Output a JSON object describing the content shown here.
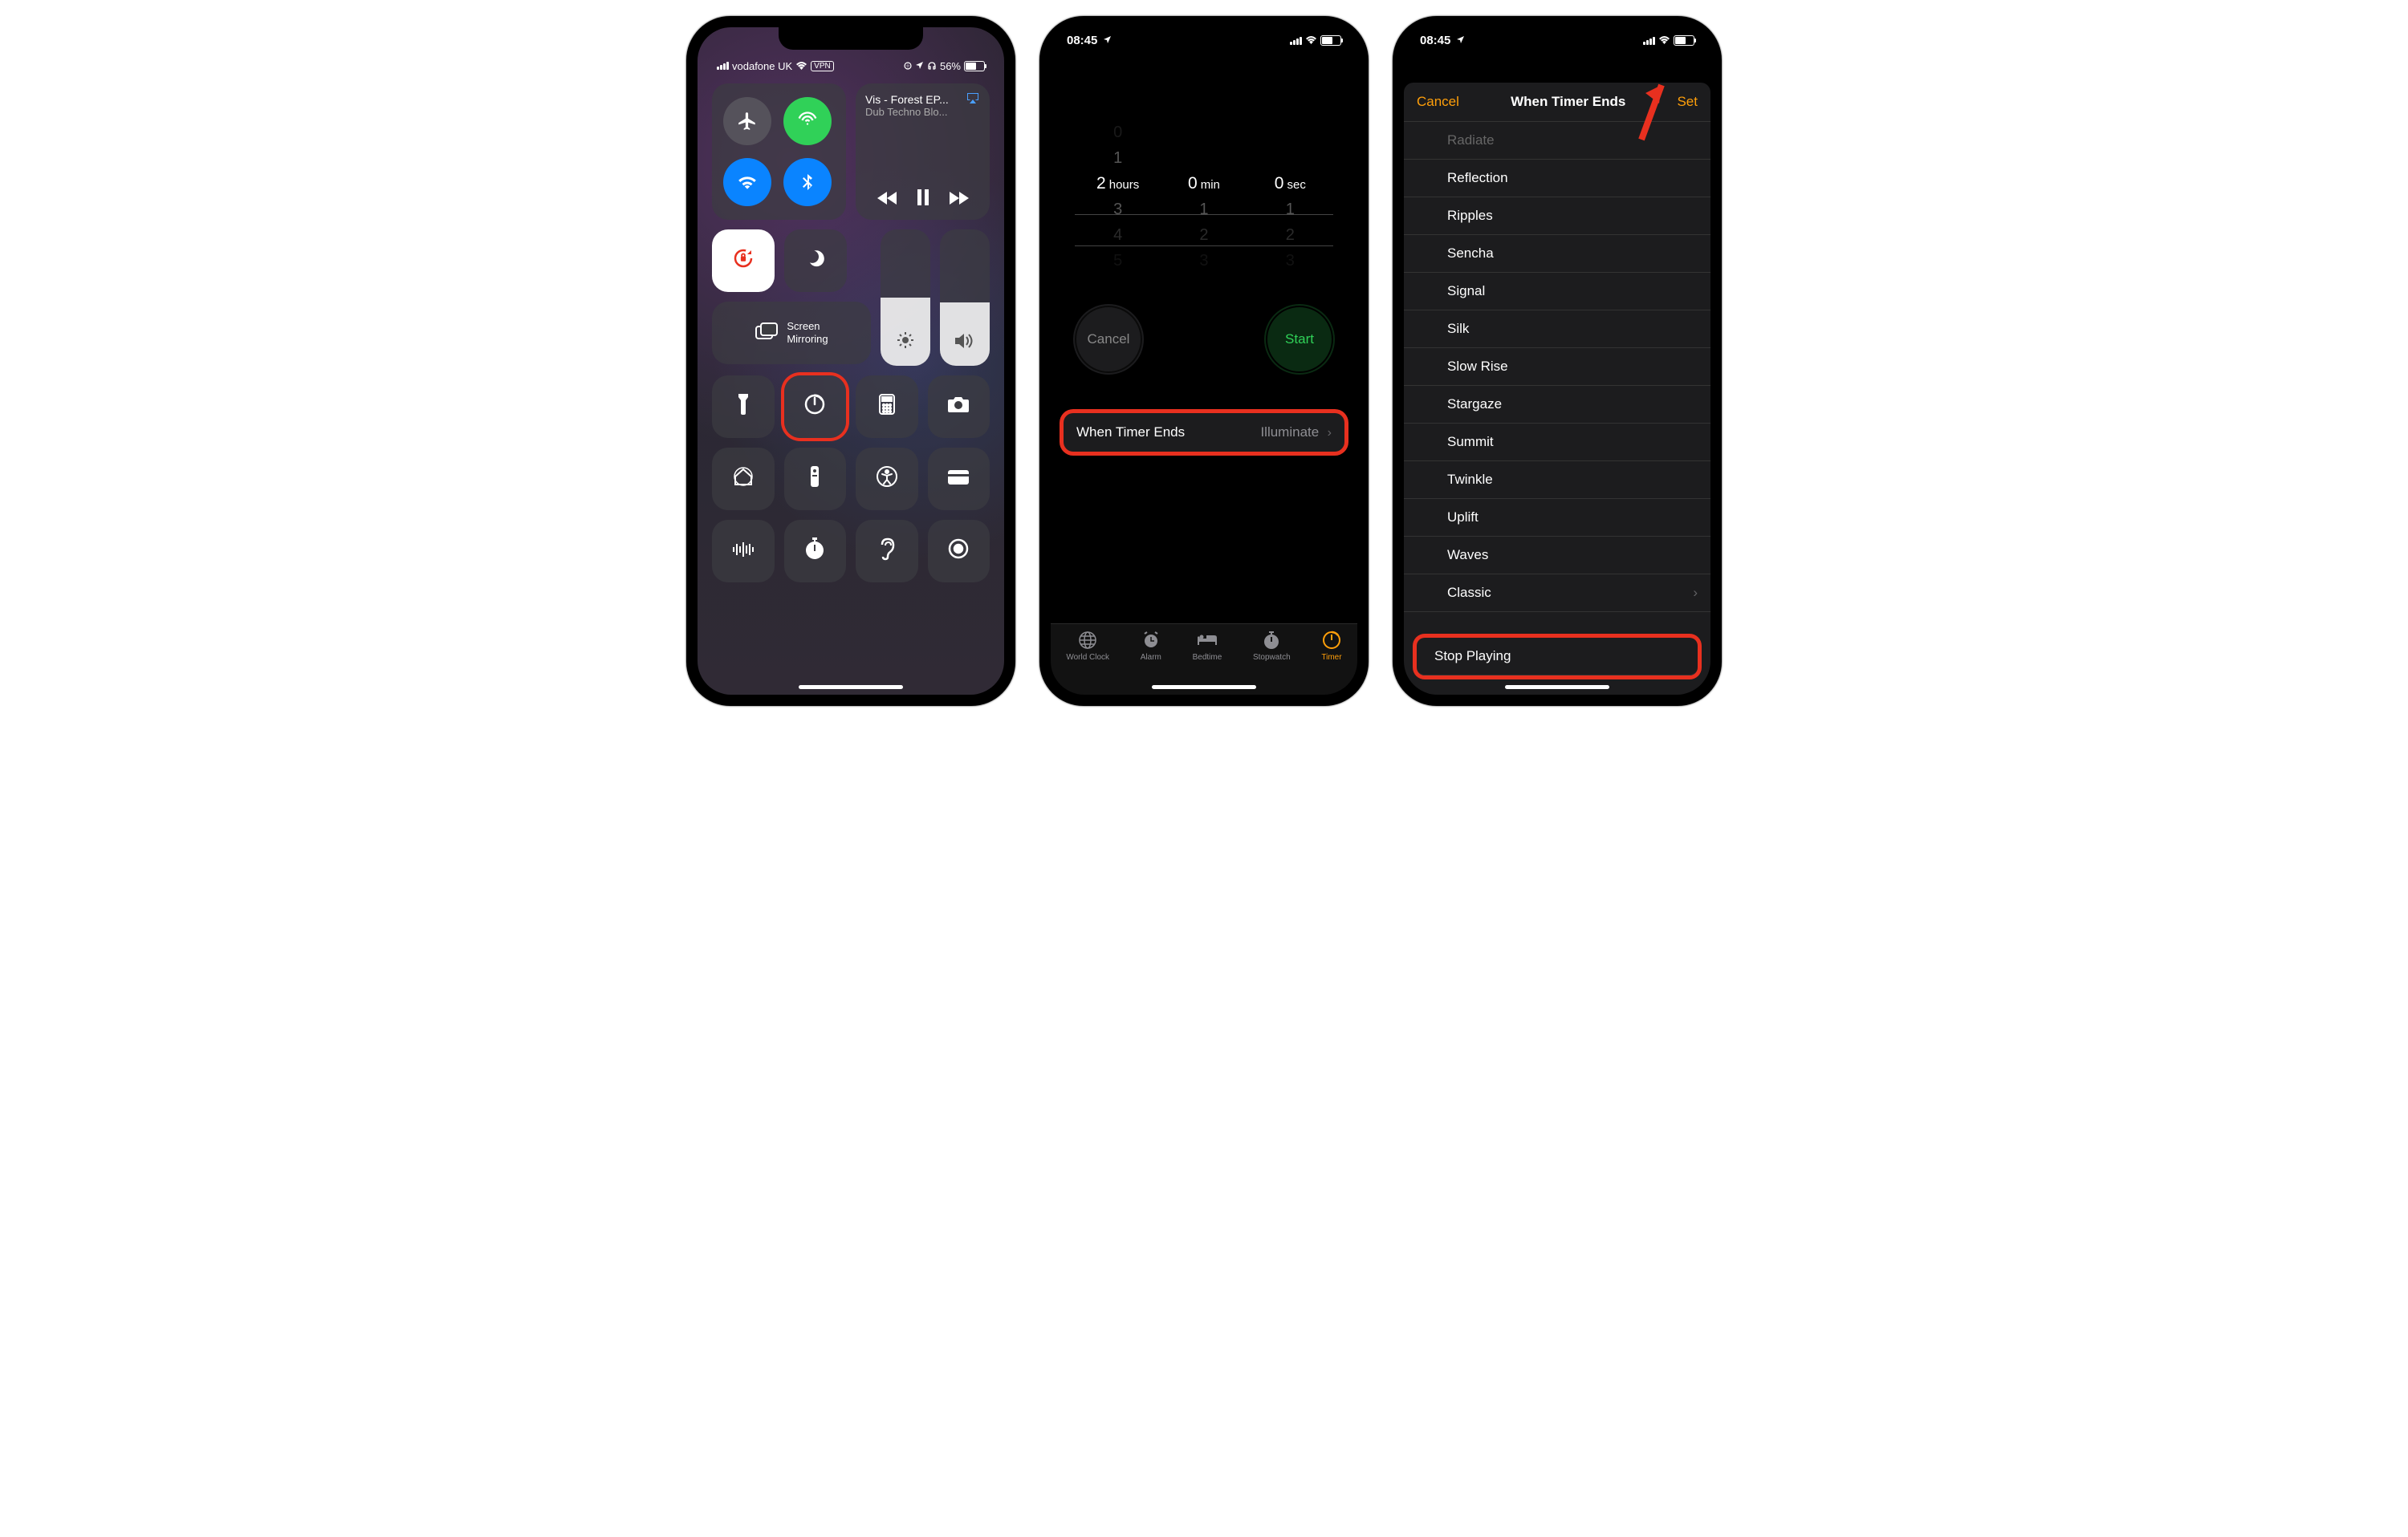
{
  "screen1": {
    "status": {
      "carrier": "vodafone UK",
      "vpn": "VPN",
      "battery": "56%"
    },
    "media": {
      "title": "Vis - Forest EP...",
      "subtitle": "Dub Techno Blo..."
    },
    "screen_mirror_label": "Screen\nMirroring"
  },
  "screen2": {
    "status_time": "08:45",
    "picker": {
      "hours_above2": "0",
      "hours_above": "1",
      "hours": "2",
      "hours_unit": "hours",
      "hours_below": "3",
      "hours_below2": "4",
      "hours_below3": "5",
      "min": "0",
      "min_unit": "min",
      "min_below": "1",
      "min_below2": "2",
      "min_below3": "3",
      "sec": "0",
      "sec_unit": "sec",
      "sec_below": "1",
      "sec_below2": "2",
      "sec_below3": "3"
    },
    "cancel": "Cancel",
    "start": "Start",
    "when_ends_label": "When Timer Ends",
    "when_ends_value": "Illuminate",
    "tabs": {
      "world_clock": "World Clock",
      "alarm": "Alarm",
      "bedtime": "Bedtime",
      "stopwatch": "Stopwatch",
      "timer": "Timer"
    }
  },
  "screen3": {
    "status_time": "08:45",
    "cancel": "Cancel",
    "title": "When Timer Ends",
    "set": "Set",
    "sounds": [
      "Radiate",
      "Reflection",
      "Ripples",
      "Sencha",
      "Signal",
      "Silk",
      "Slow Rise",
      "Stargaze",
      "Summit",
      "Twinkle",
      "Uplift",
      "Waves",
      "Classic"
    ],
    "stop_playing": "Stop Playing"
  }
}
